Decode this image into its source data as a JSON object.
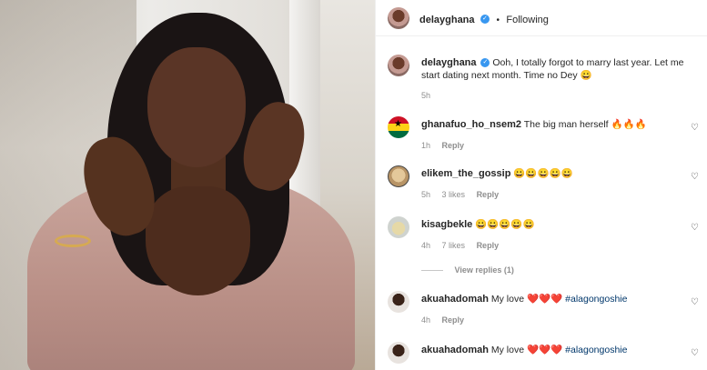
{
  "post": {
    "author": "delayghana",
    "follow_status": "Following",
    "dot": "•",
    "verified_glyph": "✓"
  },
  "caption": {
    "author": "delayghana",
    "text": "Ooh, I totally forgot to marry last year. Let me start dating next month. Time no Dey 😀",
    "time": "5h"
  },
  "comments": [
    {
      "user": "ghanafuo_ho_nsem2",
      "text": "The big man herself 🔥🔥🔥",
      "time": "1h",
      "likes": "",
      "reply": "Reply",
      "avatar": "ghana-flag-avatar"
    },
    {
      "user": "elikem_the_gossip",
      "text": "😀😀😀😀😀",
      "time": "5h",
      "likes": "3 likes",
      "reply": "Reply",
      "avatar": "gossip-avatar"
    },
    {
      "user": "kisagbekle",
      "text": "😀😀😀😀😀",
      "time": "4h",
      "likes": "7 likes",
      "reply": "Reply",
      "avatar": "kisa-avatar",
      "view_replies": "View replies (1)"
    },
    {
      "user": "akuahadomah",
      "text": "My love",
      "hearts": "❤️❤️❤️",
      "hashtag": "#alagongoshie",
      "time": "4h",
      "likes": "",
      "reply": "Reply",
      "avatar": "akua-avatar"
    },
    {
      "user": "akuahadomah",
      "text": "My love",
      "hearts": "❤️❤️❤️",
      "hashtag": "#alagongoshie",
      "time": "",
      "likes": "",
      "reply": "",
      "avatar": "akua-avatar"
    }
  ],
  "icons": {
    "like": "♡"
  },
  "colors": {
    "link": "#00376b",
    "verified": "#3897f0",
    "muted": "#8e8e8e"
  }
}
